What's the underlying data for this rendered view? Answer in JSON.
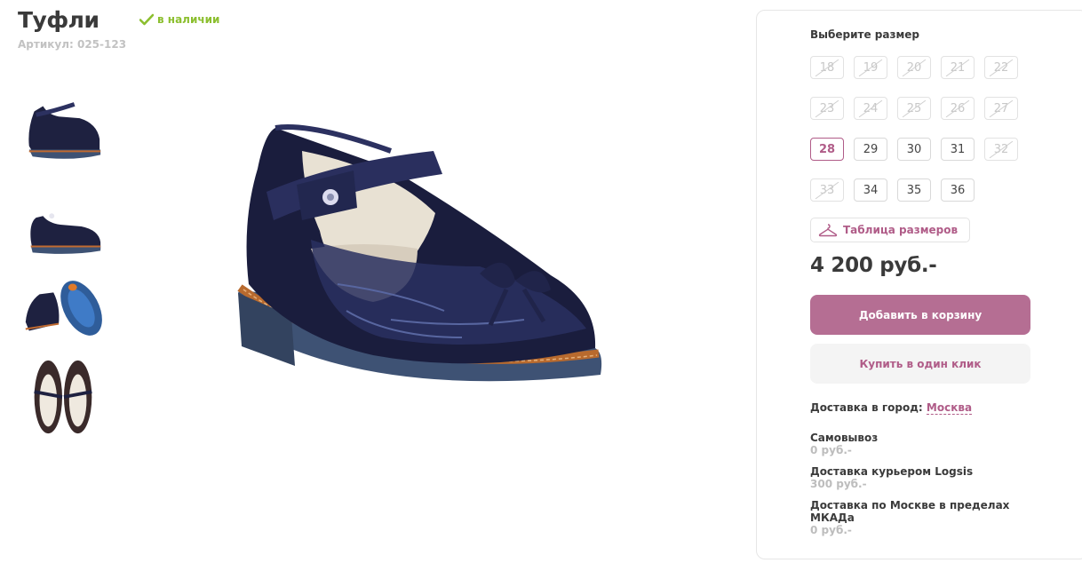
{
  "product": {
    "title": "Туфли",
    "stock_label": "в наличии",
    "sku": "Артикул: 025-123"
  },
  "size_picker": {
    "heading": "Выберите размер",
    "sizes": [
      {
        "label": "18",
        "state": "disabled"
      },
      {
        "label": "19",
        "state": "disabled"
      },
      {
        "label": "20",
        "state": "disabled"
      },
      {
        "label": "21",
        "state": "disabled"
      },
      {
        "label": "22",
        "state": "disabled"
      },
      {
        "label": "23",
        "state": "disabled"
      },
      {
        "label": "24",
        "state": "disabled"
      },
      {
        "label": "25",
        "state": "disabled"
      },
      {
        "label": "26",
        "state": "disabled"
      },
      {
        "label": "27",
        "state": "disabled"
      },
      {
        "label": "28",
        "state": "selected"
      },
      {
        "label": "29",
        "state": "available"
      },
      {
        "label": "30",
        "state": "available"
      },
      {
        "label": "31",
        "state": "available"
      },
      {
        "label": "32",
        "state": "disabled"
      },
      {
        "label": "33",
        "state": "disabled"
      },
      {
        "label": "34",
        "state": "available"
      },
      {
        "label": "35",
        "state": "available"
      },
      {
        "label": "36",
        "state": "available"
      }
    ],
    "size_table_label": "Таблица размеров",
    "size_table_icon": "hanger-icon"
  },
  "purchase": {
    "price": "4 200 руб.-",
    "add_to_cart_label": "Добавить в корзину",
    "one_click_label": "Купить в один клик"
  },
  "delivery": {
    "city_prefix": "Доставка в город:",
    "city": "Москва",
    "options": [
      {
        "name": "Самовывоз",
        "cost": "0 руб.-"
      },
      {
        "name": "Доставка курьером Logsis",
        "cost": "300 руб.-"
      },
      {
        "name": "Доставка по Москве в пределах МКАДа",
        "cost": "0 руб.-"
      }
    ]
  },
  "colors": {
    "accent": "#b56e93",
    "in_stock": "#8cbf2f",
    "muted": "#c2c2c2"
  }
}
